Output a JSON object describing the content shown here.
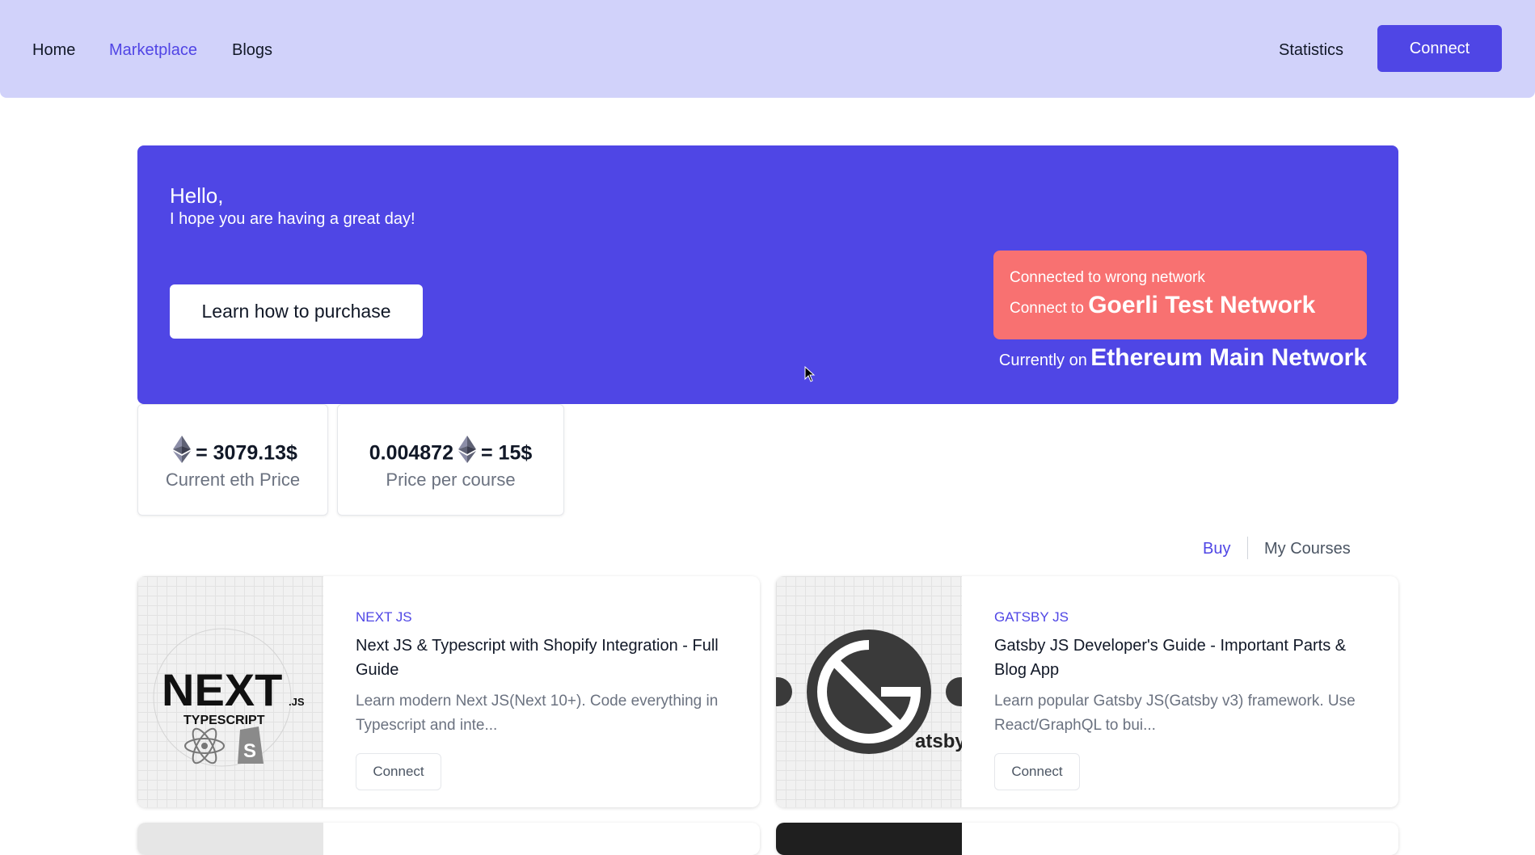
{
  "nav": {
    "links": [
      "Home",
      "Marketplace",
      "Blogs"
    ],
    "statistics": "Statistics",
    "connect": "Connect"
  },
  "hero": {
    "hello": "Hello,",
    "greeting": "I hope you are having a great day!",
    "learn_button": "Learn how to purchase",
    "warning_line1": "Connected to wrong network",
    "warning_prefix": "Connect to",
    "warning_network": "Goerli Test Network",
    "current_prefix": "Currently on",
    "current_network": "Ethereum Main Network"
  },
  "stats": {
    "eth_price": "= 3079.13$",
    "eth_price_label": "Current eth Price",
    "course_eth": "0.004872",
    "course_usd": "= 15$",
    "course_label": "Price per course"
  },
  "tabs": {
    "buy": "Buy",
    "my_courses": "My Courses"
  },
  "courses": [
    {
      "category": "NEXT JS",
      "title": "Next JS & Typescript with Shopify Integration - Full Guide",
      "description": "Learn modern Next JS(Next 10+). Code everything in Typescript and inte...",
      "button": "Connect",
      "image_text": {
        "main": "NEXT",
        "suffix": ".JS",
        "sub": "TYPESCRIPT"
      }
    },
    {
      "category": "GATSBY JS",
      "title": "Gatsby JS Developer's Guide - Important Parts & Blog App",
      "description": "Learn popular Gatsby JS(Gatsby v3) framework. Use React/GraphQL to bui...",
      "button": "Connect",
      "image_text": {
        "main": "atsby"
      }
    }
  ],
  "colors": {
    "accent": "#4f46e5",
    "topbar": "#d1d2fa",
    "warning": "#f87171"
  }
}
